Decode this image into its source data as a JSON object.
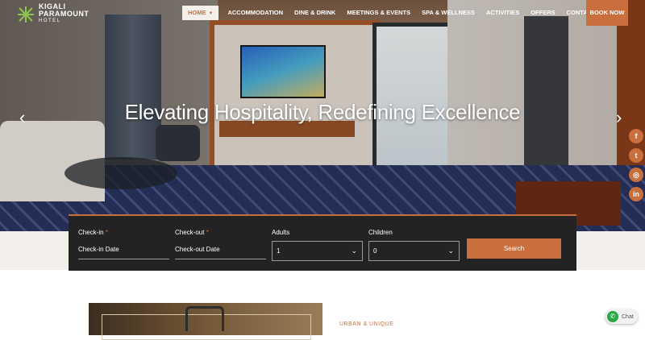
{
  "brand": {
    "name_line1": "KIGALI",
    "name_line2": "PARAMOUNT",
    "name_line3": "HOTEL",
    "accent_color": "#c96e3d"
  },
  "nav": {
    "items": [
      {
        "label": "HOME"
      },
      {
        "label": "ACCOMMODATION"
      },
      {
        "label": "DINE & DRINK"
      },
      {
        "label": "MEETINGS & EVENTS"
      },
      {
        "label": "SPA & WELLNESS"
      },
      {
        "label": "ACTIVITIES"
      },
      {
        "label": "OFFERS"
      },
      {
        "label": "CONTACT US"
      }
    ],
    "book_label": "BOOK NOW"
  },
  "hero": {
    "headline": "Elevating Hospitality, Redefining Excellence",
    "prev_icon": "chevron-left-icon",
    "next_icon": "chevron-right-icon"
  },
  "social": [
    {
      "icon": "facebook-icon",
      "glyph": "f"
    },
    {
      "icon": "twitter-icon",
      "glyph": "t"
    },
    {
      "icon": "instagram-icon",
      "glyph": "◎"
    },
    {
      "icon": "linkedin-icon",
      "glyph": "in"
    }
  ],
  "booking": {
    "checkin_label": "Check-in",
    "checkin_placeholder": "Check-in Date",
    "checkout_label": "Check-out",
    "checkout_placeholder": "Check-out Date",
    "adults_label": "Adults",
    "adults_value": "1",
    "children_label": "Children",
    "children_value": "0",
    "required_mark": "*",
    "search_label": "Search"
  },
  "promo": {
    "tagline": "URBAN & UNIQUE"
  },
  "chat": {
    "label": "Chat",
    "icon": "whatsapp-icon"
  }
}
